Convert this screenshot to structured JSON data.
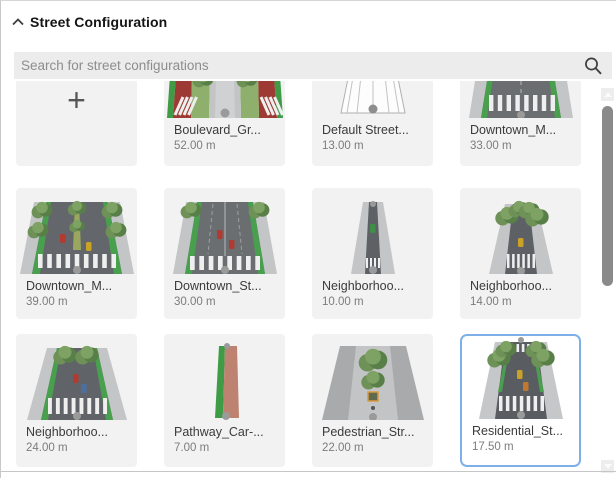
{
  "panel": {
    "title": "Street Configuration",
    "collapse_icon": "chevron-up"
  },
  "search": {
    "placeholder": "Search for street configurations",
    "value": "",
    "icon": "magnifier"
  },
  "add_tile": {
    "symbol": "+"
  },
  "tiles": [
    {
      "name": "Boulevard_Gr...",
      "width": "52.00 m",
      "thumb": "boulevard",
      "row": 1,
      "clipped": true,
      "selected": false
    },
    {
      "name": "Default Street...",
      "width": "13.00 m",
      "thumb": "wireframe",
      "row": 1,
      "clipped": true,
      "selected": false
    },
    {
      "name": "Downtown_M...",
      "width": "33.00 m",
      "thumb": "downtown33",
      "row": 1,
      "clipped": true,
      "selected": false
    },
    {
      "name": "Downtown_M...",
      "width": "39.00 m",
      "thumb": "downtown39",
      "row": 2,
      "clipped": false,
      "selected": false
    },
    {
      "name": "Downtown_St...",
      "width": "30.00 m",
      "thumb": "downtown30",
      "row": 2,
      "clipped": false,
      "selected": false
    },
    {
      "name": "Neighborhoo...",
      "width": "10.00 m",
      "thumb": "narrow10",
      "row": 2,
      "clipped": false,
      "selected": false
    },
    {
      "name": "Neighborhoo...",
      "width": "14.00 m",
      "thumb": "trees14",
      "row": 2,
      "clipped": false,
      "selected": false
    },
    {
      "name": "Neighborhoo...",
      "width": "24.00 m",
      "thumb": "green24",
      "row": 3,
      "clipped": false,
      "selected": false
    },
    {
      "name": "Pathway_Car-...",
      "width": "7.00 m",
      "thumb": "pathway7",
      "row": 3,
      "clipped": false,
      "selected": false
    },
    {
      "name": "Pedestrian_Str...",
      "width": "22.00 m",
      "thumb": "pedestrian22",
      "row": 3,
      "clipped": false,
      "selected": false
    },
    {
      "name": "Residential_St...",
      "width": "17.50 m",
      "thumb": "residential17",
      "row": 3,
      "clipped": false,
      "selected": true
    }
  ],
  "colors": {
    "selection_border": "#7fafe8",
    "tile_background": "#f2f2f2",
    "search_background": "#ececec",
    "asphalt": "#63676b",
    "sidewalk": "#c4c6c7",
    "bike_lane_green": "#48a04e",
    "bus_lane_red": "#9c3a33",
    "pathway_terracotta": "#bd8270",
    "scroll_thumb": "#8a8a8a"
  }
}
